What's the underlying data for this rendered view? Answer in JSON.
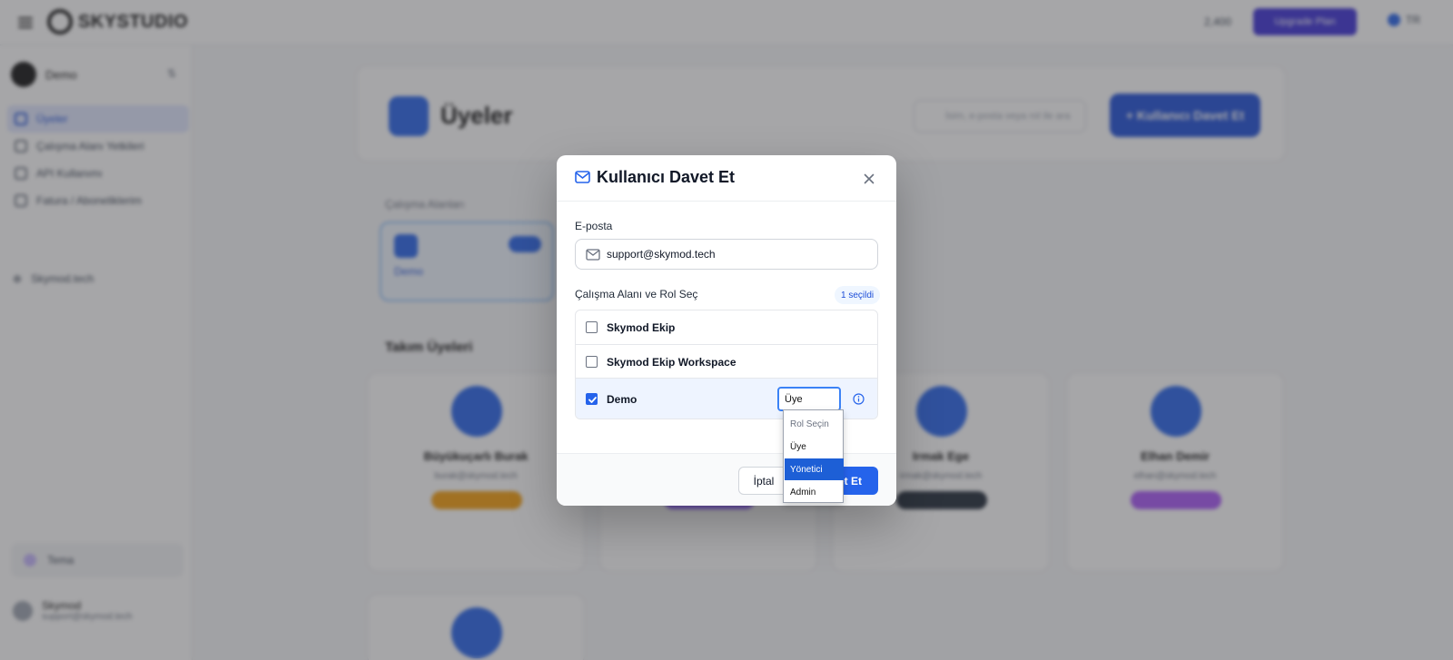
{
  "background": {
    "brand": "SKYSTUDIO",
    "credits": "2,400",
    "upgrade_label": "Upgrade Plan",
    "language": "TR",
    "workspace_name": "Demo",
    "nav_items": [
      "Üyeler",
      "Çalışma Alanı Yetkileri",
      "API Kullanımı",
      "Fatura / Aboneliklerim"
    ],
    "nav_external": "Skymod.tech",
    "theme_label": "Tema",
    "user_name": "Skymod",
    "user_email": "support@skymod.tech",
    "page_title": "Üyeler",
    "search_placeholder": "İsim, e-posta veya rol ile ara",
    "invite_label": "+ Kullanıcı Davet Et",
    "workspaces_label": "Çalışma Alanları",
    "workspace_card": "Demo",
    "team_label": "Takım Üyeleri",
    "members": [
      {
        "name": "Büyükuçarlı Burak",
        "email": "burak@skymod.tech",
        "role_color": "#f59e0b"
      },
      {
        "name": "",
        "email": "",
        "role_color": "#8b5cf6"
      },
      {
        "name": "Irmak Ege",
        "email": "irmak@skymod.tech",
        "role_color": "#1f2937"
      },
      {
        "name": "Elhan Demir",
        "email": "elhan@skymod.tech",
        "role_color": "#a855f7"
      }
    ]
  },
  "modal": {
    "title": "Kullanıcı Davet Et",
    "email_label": "E-posta",
    "email_value": "support@skymod.tech",
    "workspace_label": "Çalışma Alanı ve Rol Seç",
    "selected_badge": "1 seçildi",
    "workspaces": [
      {
        "name": "Skymod Ekip",
        "checked": false
      },
      {
        "name": "Skymod Ekip Workspace",
        "checked": false
      },
      {
        "name": "Demo",
        "checked": true,
        "role": "Üye"
      }
    ],
    "cancel_label": "İptal",
    "submit_label": "Davet Et"
  },
  "role_dropdown": {
    "options": [
      "Rol Seçin",
      "Üye",
      "Yönetici",
      "Admin"
    ],
    "highlighted": "Yönetici"
  },
  "colors": {
    "accent": "#2563eb",
    "overlay": "rgba(60,62,66,0.46)"
  }
}
